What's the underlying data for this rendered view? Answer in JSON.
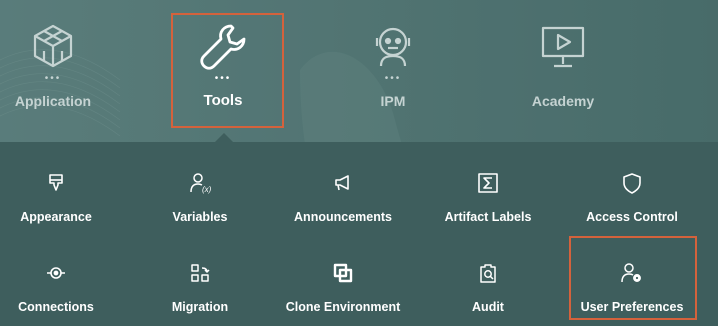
{
  "navigator": {
    "items": [
      {
        "label": "Application",
        "icon": "cube-icon",
        "dots": "•••"
      },
      {
        "label": "Tools",
        "icon": "wrench-icon",
        "dots": "•••"
      },
      {
        "label": "IPM",
        "icon": "robot-icon",
        "dots": "•••"
      },
      {
        "label": "Academy",
        "icon": "video-monitor-icon",
        "dots": ""
      }
    ],
    "active": "Tools",
    "highlight_color": "#d4623c"
  },
  "tools_panel": {
    "cards": [
      {
        "label": "Appearance",
        "icon": "brush-icon"
      },
      {
        "label": "Variables",
        "icon": "user-variable-icon"
      },
      {
        "label": "Announcements",
        "icon": "megaphone-icon"
      },
      {
        "label": "Artifact Labels",
        "icon": "sigma-icon"
      },
      {
        "label": "Access Control",
        "icon": "shield-icon"
      },
      {
        "label": "Connections",
        "icon": "connections-icon"
      },
      {
        "label": "Migration",
        "icon": "migration-icon"
      },
      {
        "label": "Clone Environment",
        "icon": "clone-icon"
      },
      {
        "label": "Audit",
        "icon": "audit-icon"
      },
      {
        "label": "User Preferences",
        "icon": "user-gear-icon"
      }
    ],
    "highlighted_card": "User Preferences"
  },
  "colors": {
    "background": "#4d716f",
    "panel": "#3e5e5d",
    "highlight": "#d4623c"
  }
}
